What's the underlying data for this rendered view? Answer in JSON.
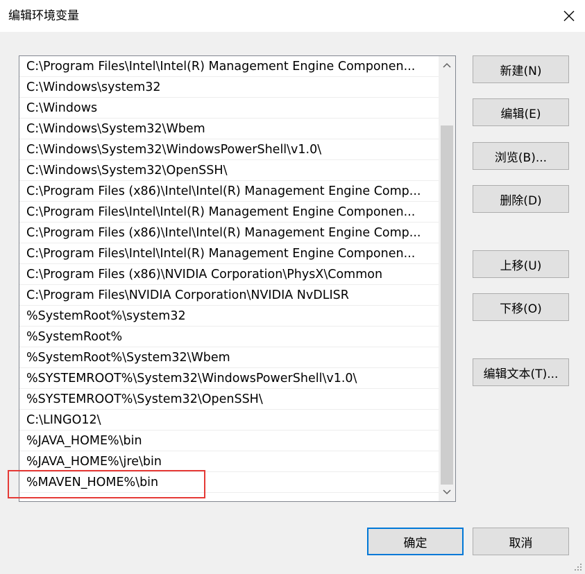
{
  "window": {
    "title": "编辑环境变量"
  },
  "list": {
    "items": [
      "C:\\Program Files\\Intel\\Intel(R) Management Engine Componen...",
      "C:\\Windows\\system32",
      "C:\\Windows",
      "C:\\Windows\\System32\\Wbem",
      "C:\\Windows\\System32\\WindowsPowerShell\\v1.0\\",
      "C:\\Windows\\System32\\OpenSSH\\",
      "C:\\Program Files (x86)\\Intel\\Intel(R) Management Engine Comp...",
      "C:\\Program Files\\Intel\\Intel(R) Management Engine Componen...",
      "C:\\Program Files (x86)\\Intel\\Intel(R) Management Engine Comp...",
      "C:\\Program Files\\Intel\\Intel(R) Management Engine Componen...",
      "C:\\Program Files (x86)\\NVIDIA Corporation\\PhysX\\Common",
      "C:\\Program Files\\NVIDIA Corporation\\NVIDIA NvDLISR",
      "%SystemRoot%\\system32",
      "%SystemRoot%",
      "%SystemRoot%\\System32\\Wbem",
      "%SYSTEMROOT%\\System32\\WindowsPowerShell\\v1.0\\",
      "%SYSTEMROOT%\\System32\\OpenSSH\\",
      "C:\\LINGO12\\",
      "%JAVA_HOME%\\bin",
      "%JAVA_HOME%\\jre\\bin",
      "%MAVEN_HOME%\\bin"
    ]
  },
  "buttons": {
    "new": "新建(N)",
    "edit": "编辑(E)",
    "browse": "浏览(B)...",
    "delete": "删除(D)",
    "move_up": "上移(U)",
    "move_down": "下移(O)",
    "edit_text": "编辑文本(T)...",
    "ok": "确定",
    "cancel": "取消"
  },
  "colors": {
    "highlight": "#e53935",
    "primary_border": "#0078d7"
  }
}
